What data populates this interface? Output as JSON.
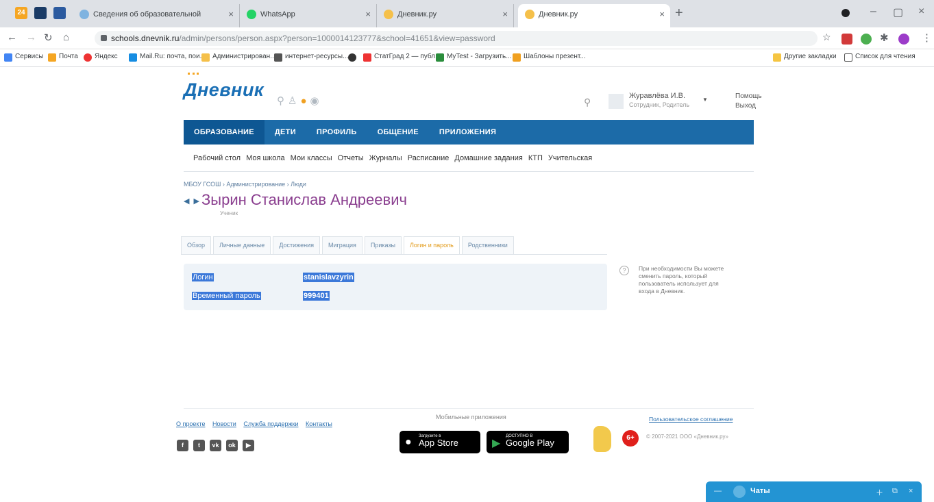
{
  "browser": {
    "tabs": [
      {
        "label": "Сведения об образовательной",
        "active": false
      },
      {
        "label": "WhatsApp",
        "active": false
      },
      {
        "label": "Дневник.ру",
        "active": false
      },
      {
        "label": "Дневник.ру",
        "active": true
      }
    ],
    "pinned": [
      "24",
      "",
      ""
    ],
    "url_host": "schools.dnevnik.ru",
    "url_path": "/admin/persons/person.aspx?person=1000014123777&school=41651&view=password",
    "bookmarks": [
      "Сервисы",
      "Почта",
      "Яндекс",
      "Mail.Ru: почта, пои...",
      "Администрирован...",
      "интернет-ресурсы...",
      "",
      "СтатГрад 2 — публ...",
      "MyTest - Загрузить...",
      "Шаблоны презент...",
      "Другие закладки",
      "Список для чтения"
    ]
  },
  "site": {
    "logo": "Дневник",
    "user": {
      "name": "Журавлёва И.В.",
      "role": "Сотрудник, Родитель"
    },
    "help": "Помощь",
    "logout": "Выход",
    "main_nav": [
      "ОБРАЗОВАНИЕ",
      "ДЕТИ",
      "ПРОФИЛЬ",
      "ОБЩЕНИЕ",
      "ПРИЛОЖЕНИЯ"
    ],
    "sub_nav": [
      "Рабочий стол",
      "Моя школа",
      "Мои классы",
      "Отчеты",
      "Журналы",
      "Расписание",
      "Домашние задания",
      "КТП",
      "Учительская"
    ],
    "breadcrumb": "МБОУ ГСОШ  ›  Администрирование  ›  Люди",
    "person_name": "Зырин Станислав Андреевич",
    "person_role": "Ученик",
    "tabs": [
      "Обзор",
      "Личные данные",
      "Достижения",
      "Миграция",
      "Приказы",
      "Логин и пароль",
      "Родственники"
    ],
    "active_tab": "Логин и пароль",
    "login_label": "Логин",
    "login_value": "stanislavzyrin",
    "password_label": "Временный пароль",
    "password_value": "999401",
    "hint": "При необходимости Вы можете сменить пароль, который пользователь использует для входа в Дневник."
  },
  "footer": {
    "links": [
      "О проекте",
      "Новости",
      "Служба поддержки",
      "Контакты"
    ],
    "mobile_title": "Мобильные приложения",
    "appstore_small": "Загрузите в",
    "appstore_big": "App Store",
    "gplay_small": "ДОСТУПНО В",
    "gplay_big": "Google Play",
    "age": "6+",
    "agreement": "Пользовательское соглашение",
    "copyright": "© 2007-2021 ООО «Дневник.ру»"
  },
  "chat": {
    "label": "Чаты"
  },
  "colors": {
    "nav": "#1c6ba8",
    "accent": "#e29a17",
    "name": "#8a3e8f",
    "chat": "#2394d3"
  }
}
